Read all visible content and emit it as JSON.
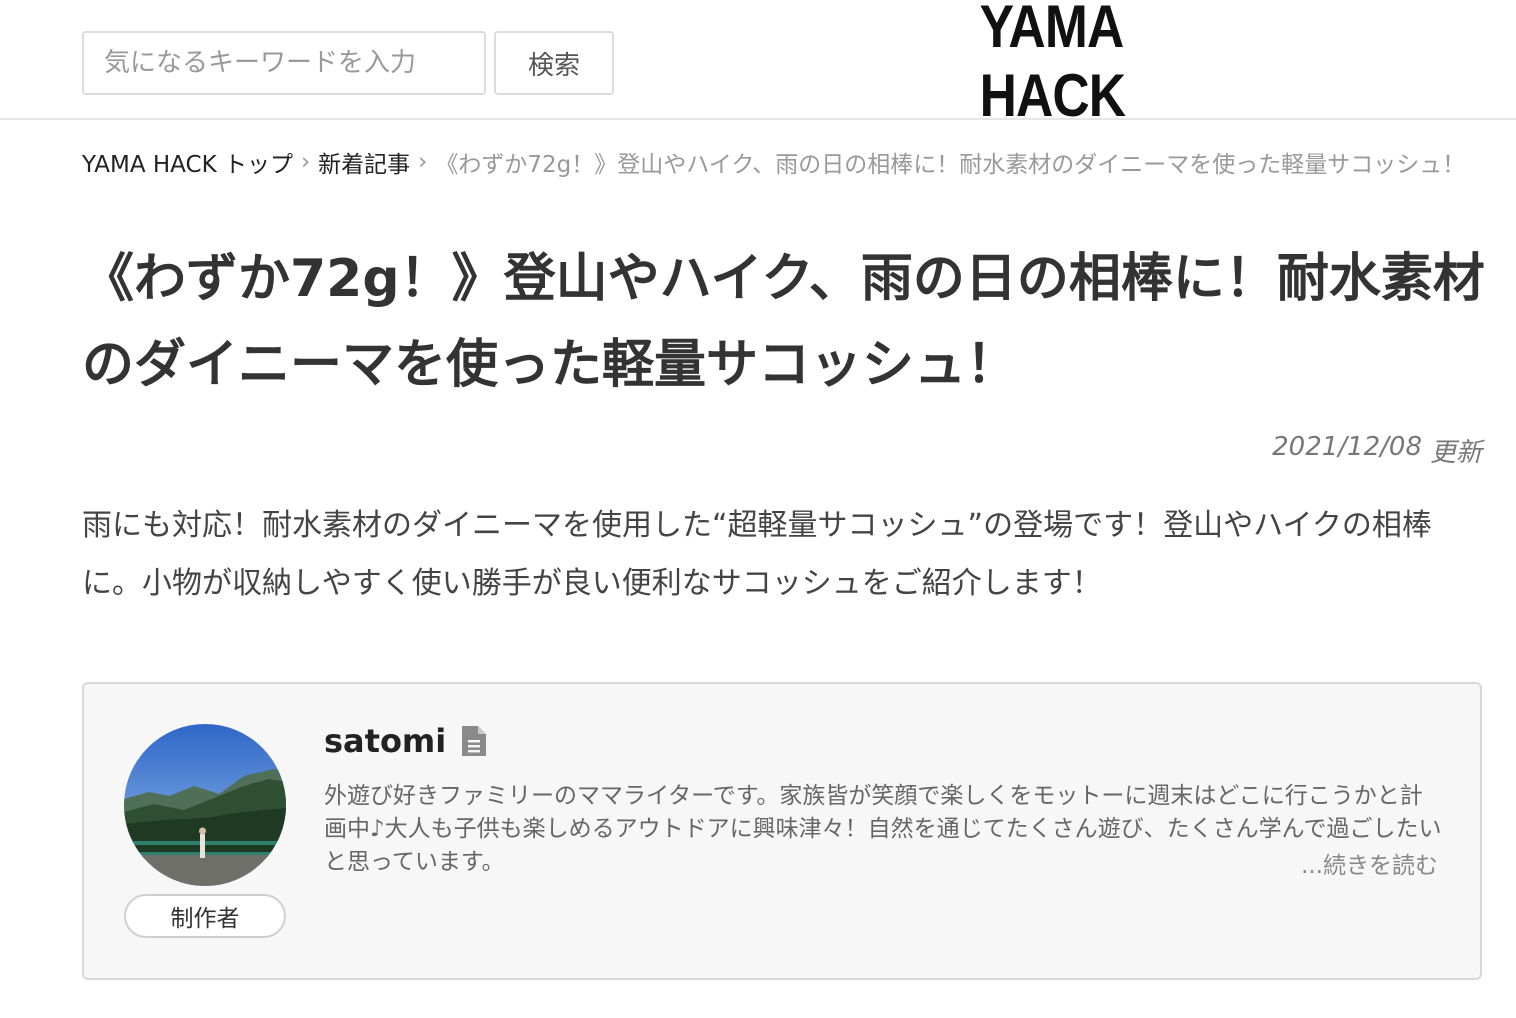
{
  "header": {
    "search_placeholder": "気になるキーワードを入力",
    "search_value": "",
    "search_button": "検索",
    "logo": "YAMA HACK"
  },
  "breadcrumb": {
    "items": [
      "YAMA HACK トップ",
      "新着記事"
    ],
    "separator": "›",
    "current": "《わずか72g！》登山やハイク、雨の日の相棒に！耐水素材のダイニーマを使った軽量サコッシュ！"
  },
  "article": {
    "title": "《わずか72g！》登山やハイク、雨の日の相棒に！耐水素材のダイニーマを使った軽量サコッシュ！",
    "date": "2021/12/08",
    "date_suffix": "更新",
    "lead": "雨にも対応！耐水素材のダイニーマを使用した“超軽量サコッシュ”の登場です！登山やハイクの相棒に。小物が収納しやすく使い勝手が良い便利なサコッシュをご紹介します！"
  },
  "author": {
    "name": "satomi",
    "role": "制作者",
    "bio": "外遊び好きファミリーのママライターです。家族皆が笑顔で楽しくをモットーに週末はどこに行こうかと計画中♪大人も子供も楽しめるアウトドアに興味津々！自然を通じてたくさん遊び、たくさん学んで過ごしたいと思っています。",
    "read_more": "...続きを読む",
    "icon": "document-icon"
  }
}
